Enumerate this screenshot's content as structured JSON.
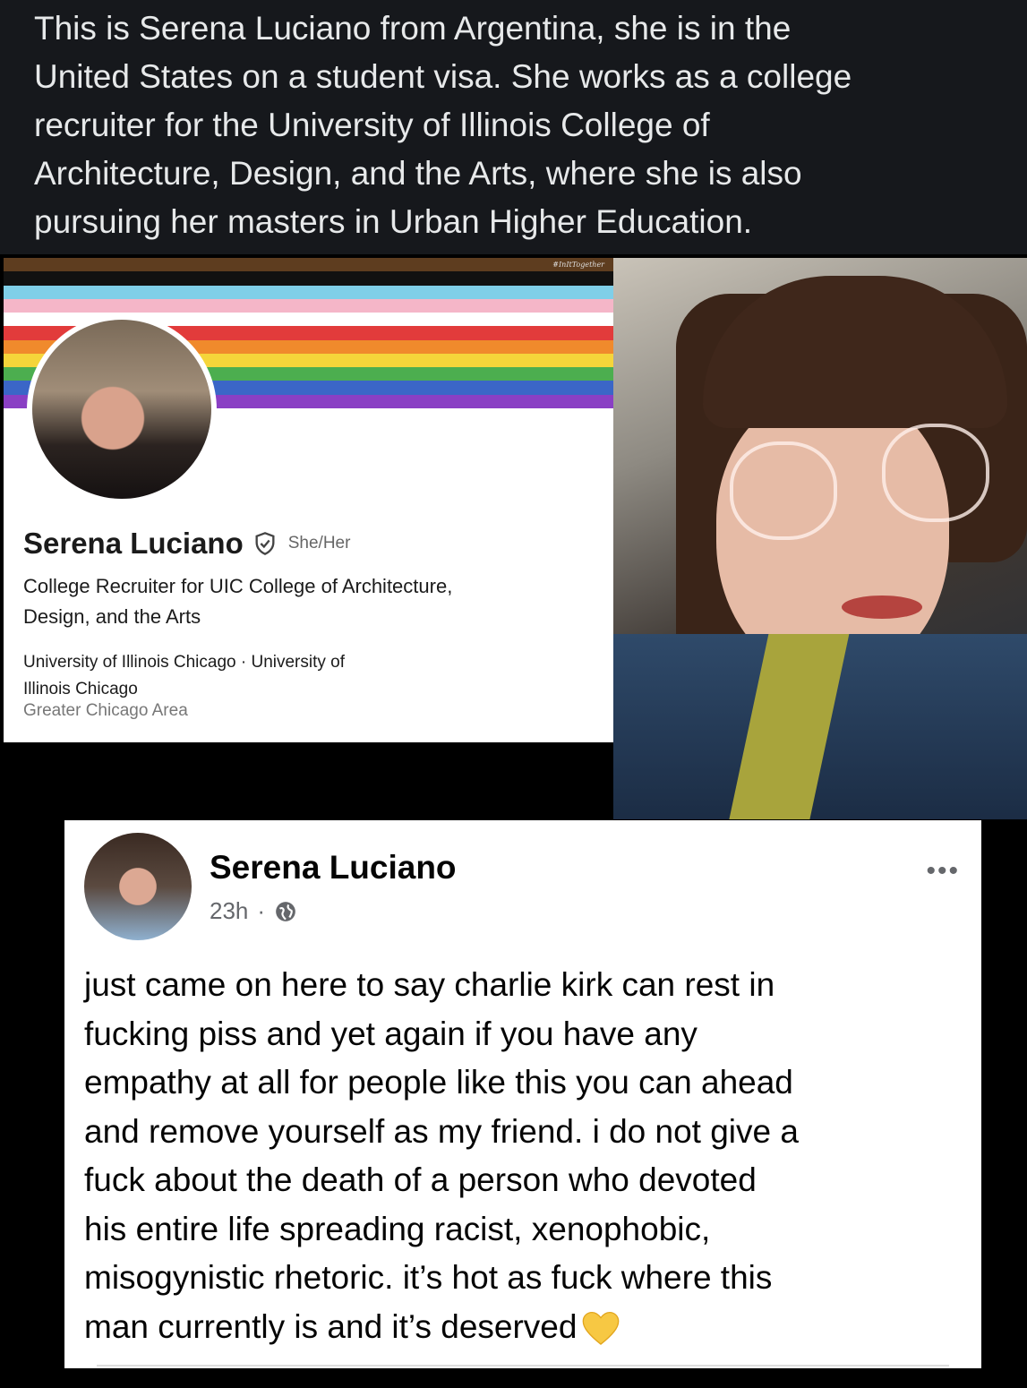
{
  "caption": {
    "lines": [
      "This is Serena Luciano from Argentina, she is in the",
      "United States on a student visa. She works as a college",
      "recruiter for the University of Illinois College of",
      "Architecture, Design, and the Arts, where she is also",
      "pursuing her masters in Urban Higher Education."
    ]
  },
  "profile": {
    "banner_tag": "#InItTogether",
    "banner_stripes": [
      "#5e3d1f",
      "#111111",
      "#7fcfe8",
      "#f5b6c8",
      "#ffffff",
      "#e23b3b",
      "#f08a2c",
      "#f5d53a",
      "#4cae4f",
      "#3b66c7",
      "#8a3fc4"
    ],
    "name": "Serena Luciano",
    "verified_icon": "shield-check-icon",
    "pronouns": "She/Her",
    "headline_lines": [
      "College Recruiter for UIC College of Architecture,",
      "Design, and the Arts"
    ],
    "employer_lines": [
      "University of Illinois Chicago · University of",
      "Illinois Chicago"
    ],
    "location": "Greater Chicago Area"
  },
  "post": {
    "author": "Serena Luciano",
    "time": "23h",
    "separator": "·",
    "audience_icon": "globe-icon",
    "more_label": "•••",
    "body_lines": [
      "just came on here to say charlie kirk can rest in",
      "fucking piss and yet again if you have any",
      "empathy at all for people like this you can ahead",
      "and remove yourself as my friend. i do not give a",
      "fuck about the death of a person who devoted",
      "his entire life spreading racist, xenophobic,",
      "misogynistic rhetoric. it’s hot as fuck where this",
      "man currently is and it’s deserved"
    ],
    "emoji": "yellow-heart-icon"
  }
}
